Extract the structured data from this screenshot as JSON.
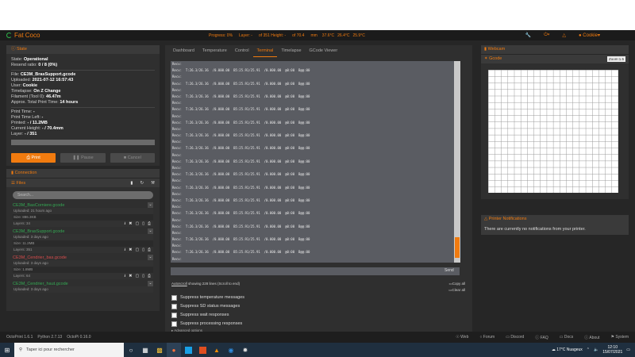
{
  "navbar": {
    "brand": "Fat Coco",
    "progress": "Progress: 0%",
    "layer": "Layer: -",
    "of_layers": "of 351 Height: -",
    "of_height": "of 70.4",
    "unit": "mm",
    "temps": [
      "37.6°C",
      "26.4°C",
      "25.9°C"
    ],
    "user": "Cookie"
  },
  "state": {
    "title": "State",
    "lines": [
      {
        "k": "State: ",
        "v": "Operational"
      },
      {
        "k": "Resend ratio: ",
        "v": "0 / 8 (0%)"
      }
    ],
    "file_lines": [
      {
        "k": "File: ",
        "v": "CE3M_BrasSupport.gcode"
      },
      {
        "k": "Uploaded: ",
        "v": "2021-07-12 16:57:43"
      },
      {
        "k": "User: ",
        "v": "Cookie"
      },
      {
        "k": "Timelapse: ",
        "v": "On Z Change"
      },
      {
        "k": "Filament (Tool 0): ",
        "v": "46.47m"
      },
      {
        "k": "Approx. Total Print Time: ",
        "v": "14 hours"
      }
    ],
    "print_lines": [
      {
        "k": "Print Time: ",
        "v": "-"
      },
      {
        "k": "Print Time Left: ",
        "v": "-"
      },
      {
        "k": "Printed: ",
        "v": "- / 11.2MB"
      },
      {
        "k": "Current Height: ",
        "v": "- / 70.4mm"
      },
      {
        "k": "Layer: ",
        "v": "- / 351"
      }
    ],
    "buttons": {
      "print": "Print",
      "pause": "Pause",
      "cancel": "Cancel"
    }
  },
  "connection": {
    "title": "Connection"
  },
  "files": {
    "title": "Files",
    "search_placeholder": "Search...",
    "items": [
      {
        "name": "CE3M_BasCorniere.gcode",
        "color": "green",
        "uploaded": "Uploaded: 21 hours ago",
        "size": "Size: 886.3KB",
        "layers": "Layers: 34"
      },
      {
        "name": "CE3M_BrasSupport.gcode",
        "color": "green",
        "uploaded": "Uploaded: 3 days ago",
        "size": "Size: 11.2MB",
        "layers": "Layers: 351"
      },
      {
        "name": "CE3M_Cendrier_bas.gcode",
        "color": "red",
        "uploaded": "Uploaded: 3 days ago",
        "size": "Size: 1.8MB",
        "layers": "Layers: 64"
      },
      {
        "name": "CE3M_Cendrier_haut.gcode",
        "color": "green",
        "uploaded": "Uploaded: 3 days ago",
        "size": "",
        "layers": ""
      }
    ]
  },
  "tabs": [
    "Dashboard",
    "Temperature",
    "Control",
    "Terminal",
    "Timelapse",
    "GCode Viewer"
  ],
  "terminal": {
    "recv_label": "Recv:",
    "temp_line": "T:26.3/26.36  /0.000.00  B5:25.91/25.91  /0.000.00  @0:00  B@@:00",
    "send_label": "Send",
    "autoscroll": "Autoscroll",
    "showing": "showing 228 lines (Scroll to end)",
    "copy_all": "Copy all",
    "clear_all": "Clear all",
    "options": [
      "Suppress temperature messages",
      "Suppress SD status messages",
      "Suppress wait responses",
      "Suppress processing responses"
    ],
    "advanced": "Advanced options"
  },
  "right": {
    "webcam": "Webcam",
    "gcode": "Gcode",
    "zoom": "Zoom:1.5",
    "notifications_title": "Printer Notifications",
    "notifications_text": "There are currently no notifications from your printer."
  },
  "footer": {
    "versions": [
      "OctoPrint 1.6.1",
      "Python 2.7.13",
      "OctoPi 0.16.0"
    ],
    "links": [
      "Web",
      "Forum",
      "Discord",
      "FAQ",
      "Docs",
      "About",
      "System"
    ]
  },
  "taskbar": {
    "search_placeholder": "Taper ici pour rechercher",
    "weather": "17°C  Nuageux",
    "time": "12:10",
    "date": "15/07/2021"
  }
}
